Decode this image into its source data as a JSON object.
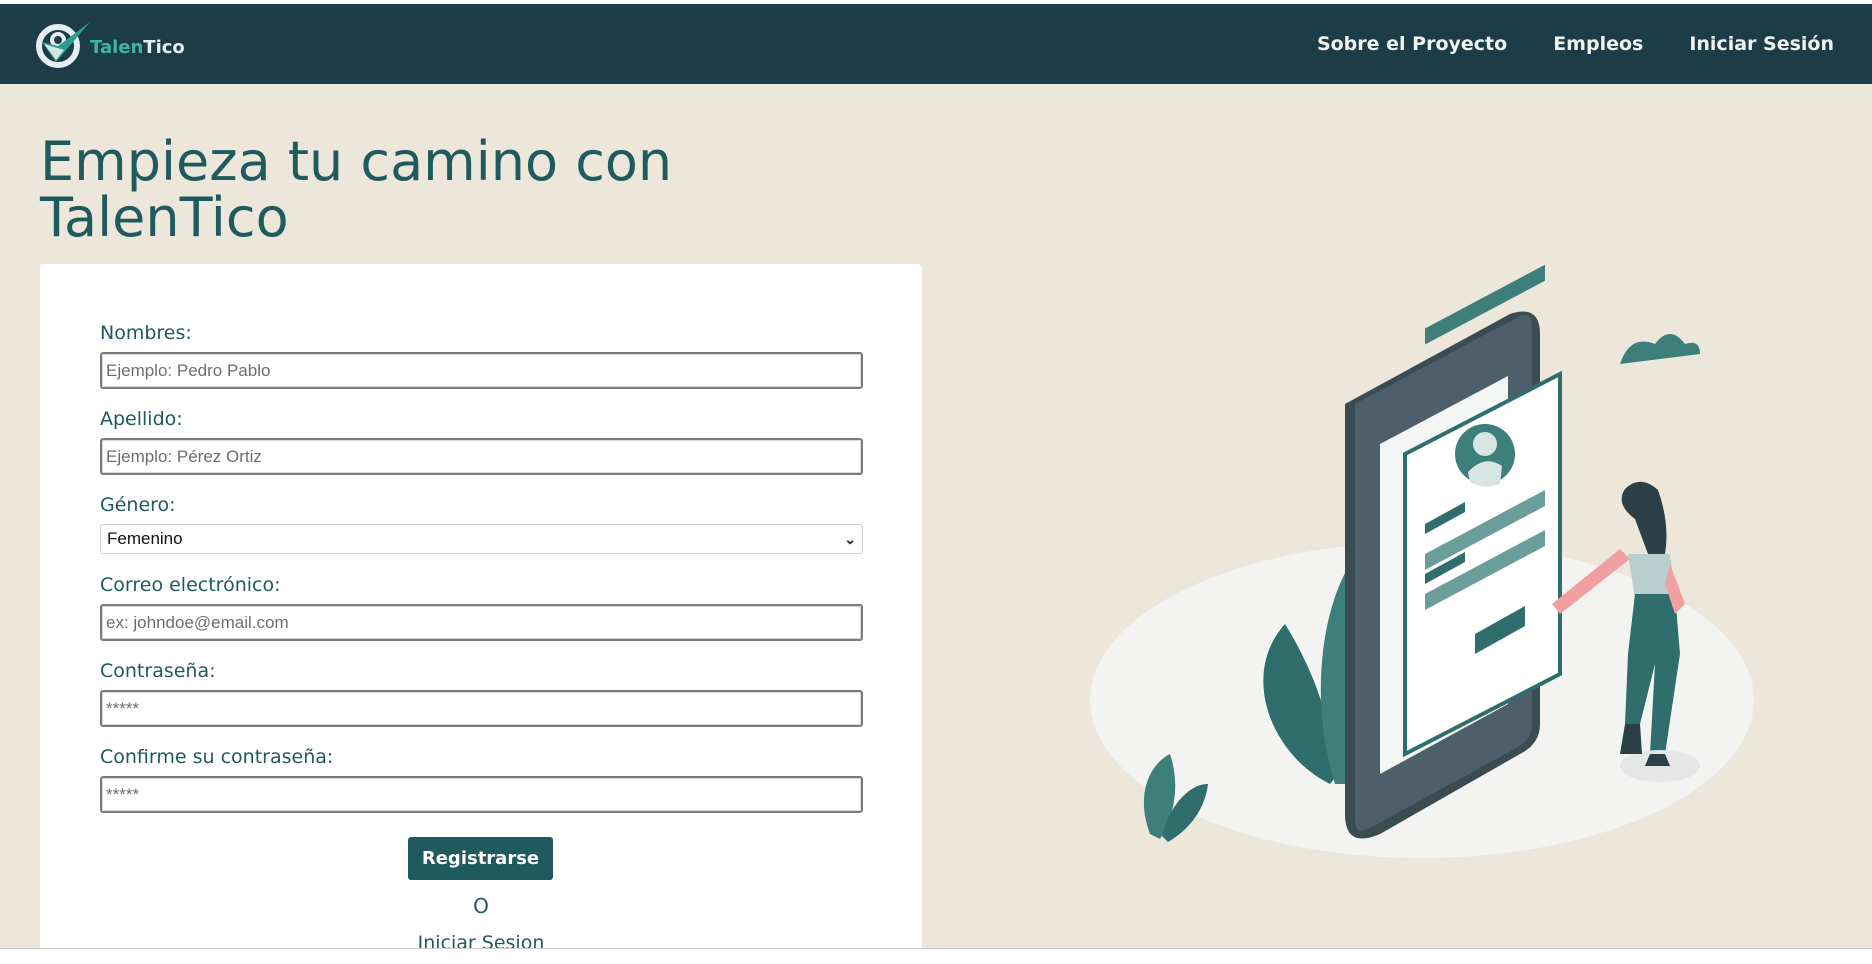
{
  "brand": {
    "name_part1": "Talen",
    "name_part2": "Tico",
    "colors": {
      "nav_bg": "#1c3d47",
      "accent": "#1f5a5e",
      "page_bg": "#ede6da",
      "teal": "#3fb3a4"
    }
  },
  "nav": {
    "items": [
      {
        "label": "Sobre el Proyecto"
      },
      {
        "label": "Empleos"
      },
      {
        "label": "Iniciar Sesión"
      }
    ]
  },
  "hero": {
    "title": "Empieza tu camino con TalenTico"
  },
  "form": {
    "first_name": {
      "label": "Nombres:",
      "placeholder": "Ejemplo: Pedro Pablo"
    },
    "last_name": {
      "label": "Apellido:",
      "placeholder": "Ejemplo: Pérez Ortiz"
    },
    "gender": {
      "label": "Género:",
      "selected": "Femenino"
    },
    "email": {
      "label": "Correo electrónico:",
      "placeholder": "ex: johndoe@email.com"
    },
    "password": {
      "label": "Contraseña:",
      "placeholder": "*****"
    },
    "confirm_password": {
      "label": "Confirme su contraseña:",
      "placeholder": "*****"
    },
    "submit_label": "Registrarse",
    "or_text": "O",
    "login_link": "Iniciar Sesion"
  }
}
